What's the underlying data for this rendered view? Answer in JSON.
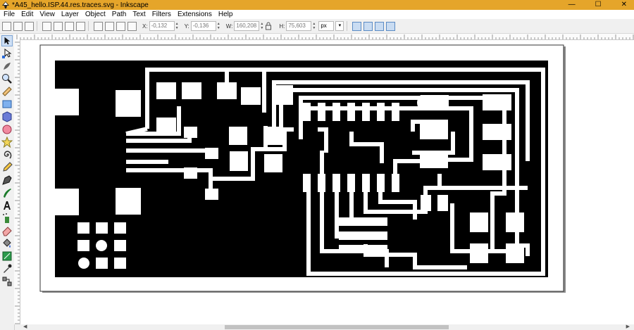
{
  "window": {
    "title": "*A45_hello.ISP.44.res.traces.svg - Inkscape",
    "controls": [
      "—",
      "☐",
      "✕"
    ]
  },
  "menu": [
    "File",
    "Edit",
    "View",
    "Layer",
    "Object",
    "Path",
    "Text",
    "Filters",
    "Extensions",
    "Help"
  ],
  "toolbar": {
    "x_label": "X:",
    "x_value": "-0,132",
    "y_label": "Y:",
    "y_value": "-0,136",
    "w_label": "W:",
    "w_value": "160,208",
    "h_label": "H:",
    "h_value": "75,603",
    "unit": "px"
  },
  "tools": [
    "selector-tool",
    "node-tool",
    "tweak-tool",
    "zoom-tool",
    "measure-tool",
    "rectangle-tool",
    "3dbox-tool",
    "ellipse-tool",
    "star-tool",
    "spiral-tool",
    "pencil-tool",
    "pen-tool",
    "calligraphy-tool",
    "text-tool",
    "spray-tool",
    "eraser-tool",
    "bucket-tool",
    "gradient-tool",
    "dropper-tool",
    "connector-tool"
  ],
  "colors": {
    "titlebar": "#e5a52a",
    "pcb_fill": "#000000",
    "trace": "#ffffff",
    "selected_button": "#c9dcf2"
  }
}
